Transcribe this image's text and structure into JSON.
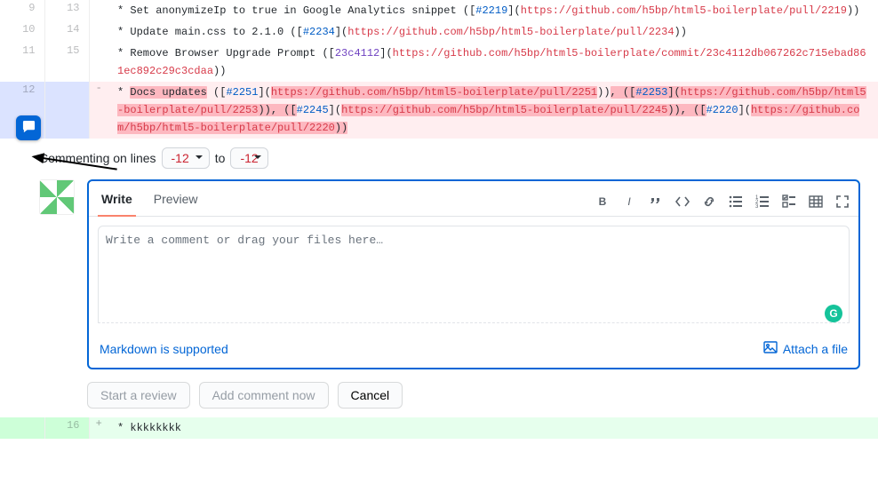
{
  "diff": {
    "rows": [
      {
        "old": "9",
        "new": "13",
        "marker": "",
        "segments": [
          {
            "t": "* Set anonymizeIp to true in Google Analytics snippet (["
          },
          {
            "t": "#2219",
            "cls": "issue"
          },
          {
            "t": "]("
          },
          {
            "t": "https://github.com/h5bp/html5-boilerplate/pull/2219",
            "cls": "url"
          },
          {
            "t": "))"
          }
        ]
      },
      {
        "old": "10",
        "new": "14",
        "marker": "",
        "segments": [
          {
            "t": "* Update main.css to 2.1.0 (["
          },
          {
            "t": "#2234",
            "cls": "issue"
          },
          {
            "t": "]("
          },
          {
            "t": "https://github.com/h5bp/html5-boilerplate/pull/2234",
            "cls": "url"
          },
          {
            "t": "))"
          }
        ]
      },
      {
        "old": "11",
        "new": "15",
        "marker": "",
        "segments": [
          {
            "t": "* Remove Browser Upgrade Prompt (["
          },
          {
            "t": "23c4112",
            "cls": "commit"
          },
          {
            "t": "]("
          },
          {
            "t": "https://github.com/h5bp/html5-boilerplate/commit/23c4112db067262c715ebad861ec892c29c3cdaa",
            "cls": "url"
          },
          {
            "t": "))"
          }
        ]
      },
      {
        "old": "12",
        "new": "",
        "marker": "-",
        "rowcls": "del-row",
        "segments": [
          {
            "t": "* "
          },
          {
            "t": "Docs updates",
            "cls": "hl-del"
          },
          {
            "t": " (["
          },
          {
            "t": "#2251",
            "cls": "issue"
          },
          {
            "t": "]("
          },
          {
            "t": "https://github.com/h5bp/html5-boilerplate/pull/2251",
            "cls": "url hl-del"
          },
          {
            "t": "))"
          },
          {
            "t": ", ([",
            "cls": "hl-del"
          },
          {
            "t": "#2253",
            "cls": "issue hl-del"
          },
          {
            "t": "](",
            "cls": "hl-del"
          },
          {
            "t": "https://github.com/h5bp/html5-boilerplate/pull/2253",
            "cls": "url hl-del"
          },
          {
            "t": ")), ([",
            "cls": "hl-del"
          },
          {
            "t": "#2245",
            "cls": "issue"
          },
          {
            "t": "]("
          },
          {
            "t": "https://github.com/h5bp/html5-boilerplate/pull/2245",
            "cls": "url hl-del"
          },
          {
            "t": ")), ([",
            "cls": "hl-del"
          },
          {
            "t": "#2220",
            "cls": "issue"
          },
          {
            "t": "]("
          },
          {
            "t": "https://github.com/h5bp/html5-boilerplate/pull/2220",
            "cls": "url hl-del"
          },
          {
            "t": "))",
            "cls": "hl-del"
          }
        ]
      }
    ],
    "addRow": {
      "old": "",
      "new": "16",
      "marker": "+",
      "segments": [
        {
          "t": "* kkkkkkkk"
        }
      ]
    }
  },
  "comment": {
    "prefix": "Commenting on lines",
    "from": "-12",
    "to_label": "to",
    "to": "-12",
    "tabs": {
      "write": "Write",
      "preview": "Preview"
    },
    "placeholder": "Write a comment or drag your files here…",
    "markdown": "Markdown is supported",
    "attach": "Attach a file",
    "grammarly": "G"
  },
  "buttons": {
    "start_review": "Start a review",
    "add_comment": "Add comment now",
    "cancel": "Cancel"
  }
}
